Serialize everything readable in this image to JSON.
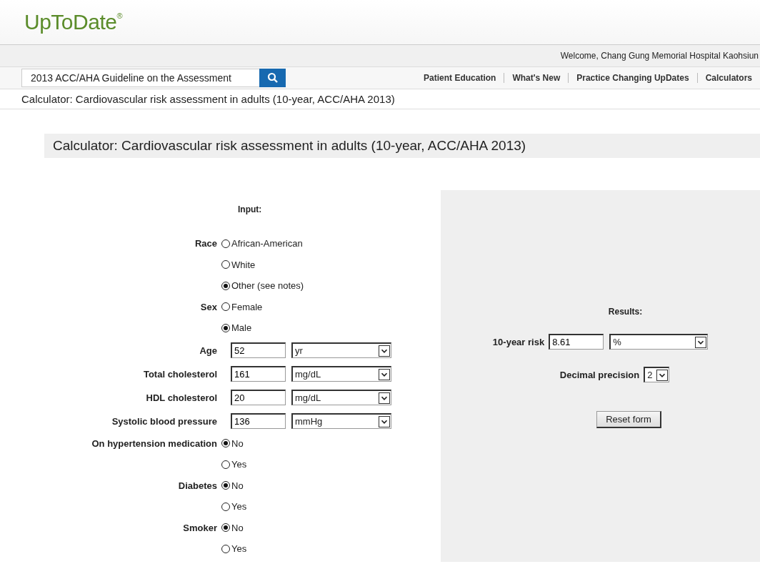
{
  "logo": "UpToDate$^{®}$",
  "welcome": "Welcome, Chang Gung Memorial Hospital Kaohsiun",
  "search": {
    "value": "2013 ACC/AHA Guideline on the Assessment"
  },
  "nav": [
    "Patient Education",
    "What's New",
    "Practice Changing UpDates",
    "Calculators"
  ],
  "breadcrumb": "Calculator: Cardiovascular risk assessment in adults (10-year, ACC/AHA 2013)",
  "title": "Calculator: Cardiovascular risk assessment in adults (10-year, ACC/AHA 2013)",
  "input_heading": "Input:",
  "fields": [
    {
      "kind": "radio",
      "label": "Race",
      "options": [
        {
          "label": "African-American",
          "selected": false
        },
        {
          "label": "White",
          "selected": false
        },
        {
          "label": "Other (see notes)",
          "selected": true
        }
      ]
    },
    {
      "kind": "radio",
      "label": "Sex",
      "options": [
        {
          "label": "Female",
          "selected": false
        },
        {
          "label": "Male",
          "selected": true
        }
      ]
    },
    {
      "kind": "number",
      "label": "Age",
      "value": "52",
      "unit": "yr"
    },
    {
      "kind": "number",
      "label": "Total cholesterol",
      "value": "161",
      "unit": "mg/dL"
    },
    {
      "kind": "number",
      "label": "HDL cholesterol",
      "value": "20",
      "unit": "mg/dL"
    },
    {
      "kind": "number",
      "label": "Systolic blood pressure",
      "value": "136",
      "unit": "mmHg"
    },
    {
      "kind": "radio",
      "label": "On hypertension medication",
      "options": [
        {
          "label": "No",
          "selected": true
        },
        {
          "label": "Yes",
          "selected": false
        }
      ]
    },
    {
      "kind": "radio",
      "label": "Diabetes",
      "options": [
        {
          "label": "No",
          "selected": true
        },
        {
          "label": "Yes",
          "selected": false
        }
      ]
    },
    {
      "kind": "radio",
      "label": "Smoker",
      "options": [
        {
          "label": "No",
          "selected": true
        },
        {
          "label": "Yes",
          "selected": false
        }
      ]
    }
  ],
  "results": {
    "heading": "Results:",
    "risk": {
      "label": "10-year risk",
      "value": "8.61",
      "unit": "%"
    },
    "precision": {
      "label": "Decimal precision",
      "value": "2"
    },
    "reset": "Reset form"
  }
}
